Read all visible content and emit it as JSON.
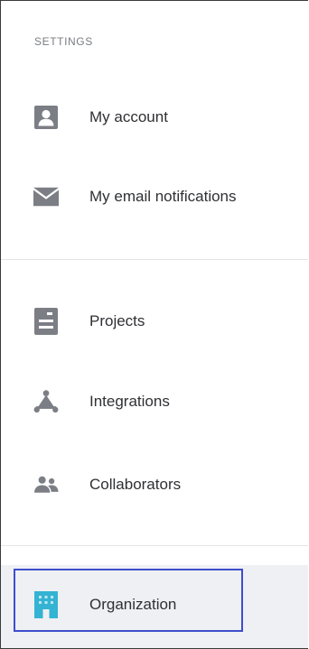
{
  "settings": {
    "section_label": "SETTINGS",
    "items": [
      {
        "label": "My account",
        "icon": "account-icon"
      },
      {
        "label": "My email notifications",
        "icon": "email-icon"
      }
    ]
  },
  "workspace": {
    "items": [
      {
        "label": "Projects",
        "icon": "projects-icon"
      },
      {
        "label": "Integrations",
        "icon": "integrations-icon"
      },
      {
        "label": "Collaborators",
        "icon": "collaborators-icon"
      }
    ]
  },
  "organization": {
    "items": [
      {
        "label": "Organization",
        "icon": "organization-icon",
        "active": true
      }
    ]
  },
  "colors": {
    "icon_gray": "#7b7e84",
    "active_icon": "#35b3d3",
    "highlight_outline": "#3f4dcc",
    "active_background": "#eef0f3"
  }
}
